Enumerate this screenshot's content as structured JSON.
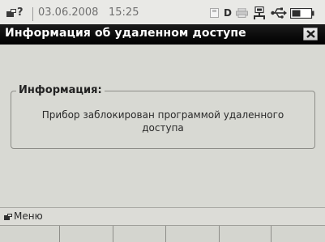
{
  "status_bar": {
    "help_mark": "?",
    "date": "03.06.2008",
    "time": "15:25",
    "drive_label": "D",
    "icons": [
      "status-icon",
      "help-icon",
      "save-icon",
      "drive-d-icon",
      "printer-icon",
      "network-icon",
      "usb-icon",
      "battery-icon"
    ]
  },
  "window": {
    "title": "Информация об удаленном доступе",
    "close_icon": "close-icon"
  },
  "info_group": {
    "legend": "Информация:",
    "message_line1": "Прибор заблокирован программой удаленного",
    "message_line2": "доступа"
  },
  "menu_bar": {
    "label": "Меню",
    "icon": "menu-icon"
  },
  "softkeys": [
    "",
    "",
    "",
    "",
    "",
    ""
  ],
  "colors": {
    "background": "#d8d9d3",
    "title_bar": "#000000",
    "title_text": "#ffffff",
    "status_bar": "#e9e9e6"
  }
}
